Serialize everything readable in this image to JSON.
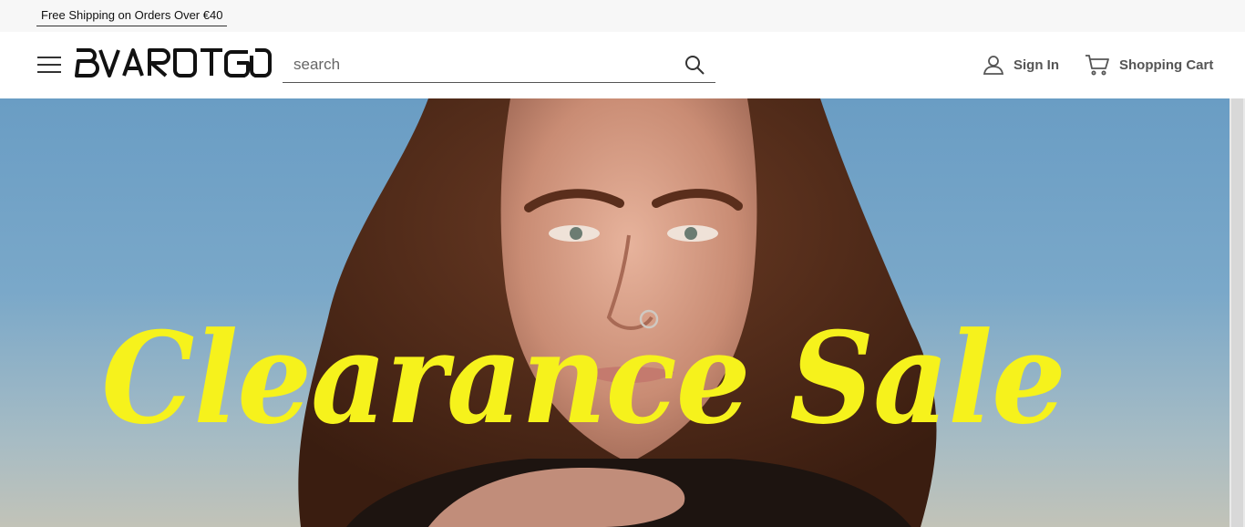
{
  "announcement": {
    "text": "Free Shipping on Orders Over €40"
  },
  "header": {
    "logo_text": "BVAROTGO",
    "menu_icon": "hamburger-menu-icon",
    "search": {
      "placeholder": "search",
      "value": "",
      "icon": "search-icon"
    },
    "sign_in": {
      "label": "Sign In",
      "icon": "user-icon"
    },
    "cart": {
      "label": "Shopping Cart",
      "icon": "shopping-cart-icon"
    }
  },
  "hero": {
    "title": "Clearance Sale",
    "title_color": "#f6f21c"
  },
  "colors": {
    "announcement_bg": "#f7f7f7",
    "header_bg": "#ffffff",
    "header_text": "#555555",
    "sky": "#6a9dc4"
  }
}
